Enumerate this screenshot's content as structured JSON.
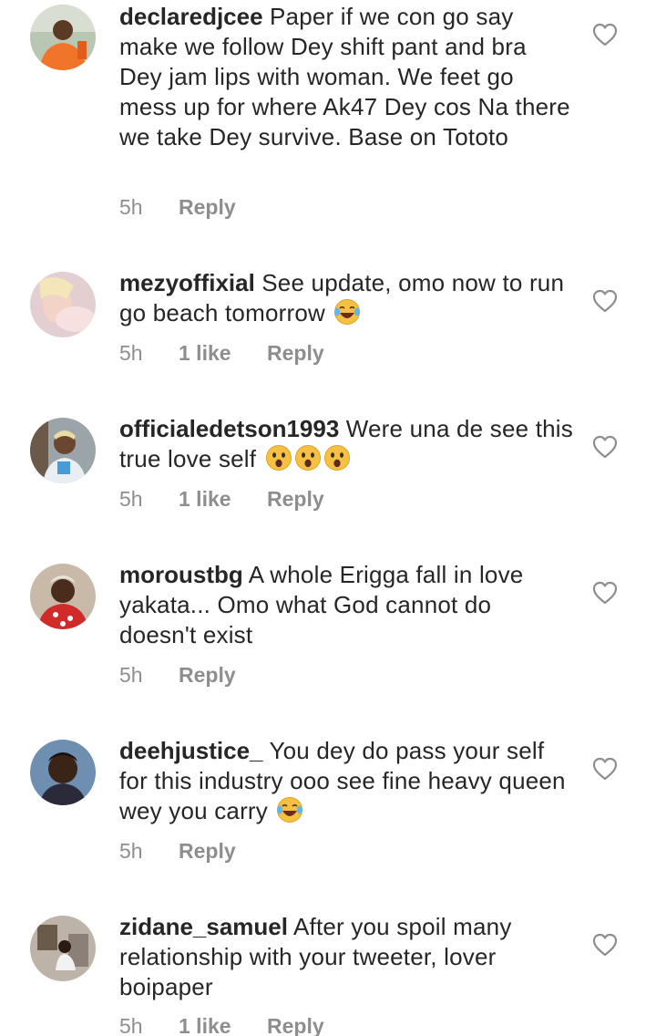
{
  "comments": [
    {
      "username": "declaredjcee",
      "text": "Paper if we con go say make we follow Dey shift pant and bra Dey jam lips with woman. We feet go mess up for where Ak47 Dey cos Na there we take Dey survive.  Base on Tototo",
      "emojis": [],
      "time": "5h",
      "likes": "",
      "reply": "Reply",
      "avatar_icon": "user-avatar-orange-shirt"
    },
    {
      "username": "mezyoffixial",
      "text": "See  update, omo  now to run go beach tomorrow",
      "emojis": [
        "face-with-tears-of-joy-emoji"
      ],
      "time": "5h",
      "likes": "1 like",
      "reply": "Reply",
      "avatar_icon": "user-avatar-pink"
    },
    {
      "username": "officialedetson1993",
      "text": "Were una de see this true love self",
      "emojis": [
        "astonished-face-emoji",
        "astonished-face-emoji",
        "astonished-face-emoji"
      ],
      "time": "5h",
      "likes": "1 like",
      "reply": "Reply",
      "avatar_icon": "user-avatar-blonde"
    },
    {
      "username": "moroustbg",
      "text": "A whole Erigga fall in love yakata... Omo what God cannot do doesn't exist",
      "emojis": [],
      "time": "5h",
      "likes": "",
      "reply": "Reply",
      "avatar_icon": "user-avatar-red"
    },
    {
      "username": "deehjustice_",
      "text": "You dey do pass your self for this industry ooo see fine  heavy queen wey you carry",
      "emojis": [
        "face-with-tears-of-joy-emoji"
      ],
      "time": "5h",
      "likes": "",
      "reply": "Reply",
      "avatar_icon": "user-avatar-dark"
    },
    {
      "username": "zidane_samuel",
      "text": "After you spoil many relationship with your tweeter, lover boipaper",
      "emojis": [],
      "time": "5h",
      "likes": "1 like",
      "reply": "Reply",
      "avatar_icon": "user-avatar-room"
    }
  ],
  "icons": {
    "like": "heart-outline-icon"
  },
  "colors": {
    "text": "#262626",
    "secondary": "#8e8e8e",
    "background": "#ffffff"
  }
}
